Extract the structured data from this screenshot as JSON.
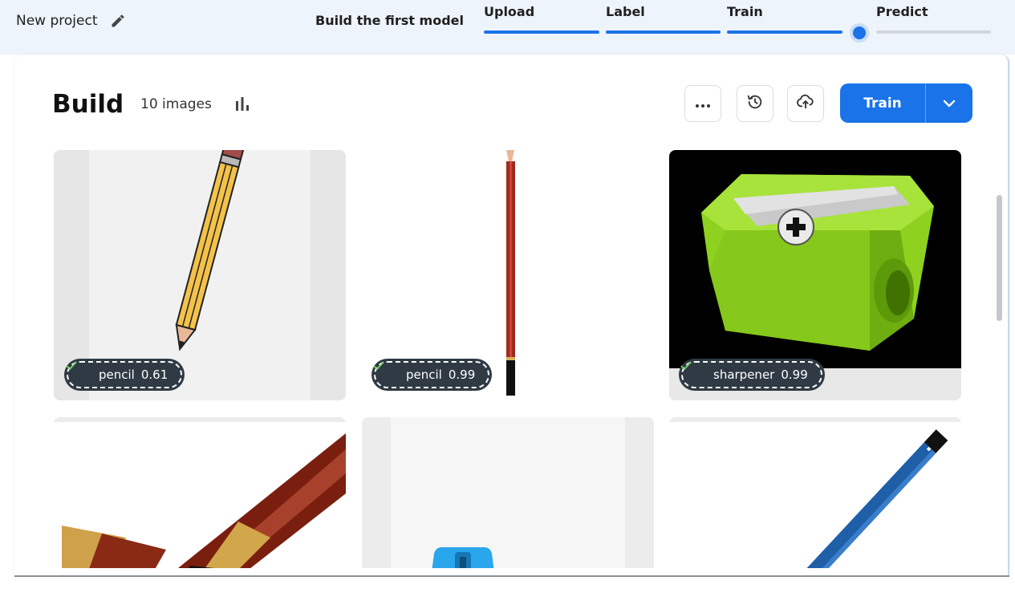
{
  "header": {
    "project_name": "New project",
    "steps_title": "Build the first model",
    "steps": [
      {
        "label": "Upload",
        "complete": true
      },
      {
        "label": "Label",
        "complete": true
      },
      {
        "label": "Train",
        "complete": true
      },
      {
        "label": "Predict",
        "complete": false
      }
    ]
  },
  "build": {
    "title": "Build",
    "image_count": "10 images",
    "train_label": "Train"
  },
  "tiles": [
    {
      "image": "cartoon pencil",
      "label": "pencil",
      "score": "0.61"
    },
    {
      "image": "red pencil",
      "label": "pencil",
      "score": "0.99"
    },
    {
      "image": "green sharpener",
      "label": "sharpener",
      "score": "0.99"
    },
    {
      "image": "fountain pen",
      "label": "",
      "score": ""
    },
    {
      "image": "blue sharpener",
      "label": "",
      "score": ""
    },
    {
      "image": "blue staedtler pencil",
      "label": "",
      "score": ""
    }
  ],
  "colors": {
    "accent": "#1a73e8",
    "pill_bg": "#2f3a44",
    "topbar_bg": "#eef4fc"
  },
  "icons": {
    "edit": "pencil-icon",
    "stats": "bar-chart-icon",
    "more": "more-horizontal-icon",
    "history": "history-icon",
    "upload": "cloud-upload-icon",
    "caret": "chevron-down-icon",
    "check": "check-icon"
  }
}
